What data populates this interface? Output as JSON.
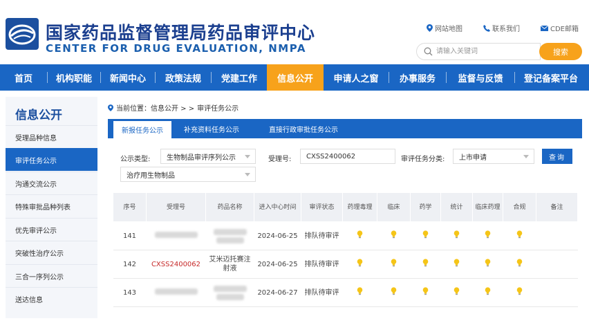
{
  "header": {
    "title_cn": "国家药品监督管理局药品审评中心",
    "title_en": "CENTER FOR DRUG EVALUATION, NMPA",
    "links": [
      {
        "label": "网站地图",
        "icon": "map-pin-icon"
      },
      {
        "label": "联系我们",
        "icon": "phone-icon"
      },
      {
        "label": "CDE邮箱",
        "icon": "mail-icon"
      }
    ],
    "search_placeholder": "请输入关键词",
    "search_button": "搜索"
  },
  "nav": {
    "items": [
      "首页",
      "机构职能",
      "新闻中心",
      "政策法规",
      "党建工作",
      "信息公开",
      "申请人之窗",
      "办事服务",
      "监督与反馈",
      "登记备案平台"
    ],
    "active_index": 5
  },
  "sidebar": {
    "title": "信息公开",
    "items": [
      "受理品种信息",
      "审评任务公示",
      "沟通交流公示",
      "特殊审批品种列表",
      "优先审评公示",
      "突破性治疗公示",
      "三合一序列公示",
      "送达信息"
    ],
    "active_index": 1
  },
  "breadcrumb": {
    "prefix": "当前位置：信息公开 > >",
    "current": "审评任务公示"
  },
  "tabs": {
    "items": [
      "新报任务公示",
      "补充资料任务公示",
      "直接行政审批任务公示"
    ],
    "active_index": 0
  },
  "filters": {
    "type_label": "公示类型:",
    "type_value": "生物制品审评序列公示",
    "sub_type_value": "治疗用生物制品",
    "acceptance_label": "受理号:",
    "acceptance_value": "CXSS2400062",
    "category_label": "审评任务分类:",
    "category_value": "上市申请",
    "query_button": "查询"
  },
  "table": {
    "headers": [
      "序号",
      "受理号",
      "药品名称",
      "进入中心时间",
      "审评状态",
      "药理毒理",
      "临床",
      "药学",
      "统计",
      "临床药理",
      "合规",
      "备注"
    ],
    "rows": [
      {
        "index": "141",
        "acceptance": "",
        "name": "",
        "date": "2024-06-25",
        "status": "排队待审评"
      },
      {
        "index": "142",
        "acceptance": "CXSS2400062",
        "name": "艾米迈托赛注射液",
        "date": "2024-06-25",
        "status": "排队待审评"
      },
      {
        "index": "143",
        "acceptance": "",
        "name": "",
        "date": "2024-06-27",
        "status": "排队待审评"
      }
    ]
  },
  "colors": {
    "primary_blue": "#1a66c4",
    "accent_orange": "#f7a21b",
    "title_blue": "#1b3f8f",
    "link_red": "#c62828",
    "bulb_yellow": "#f5c518"
  }
}
